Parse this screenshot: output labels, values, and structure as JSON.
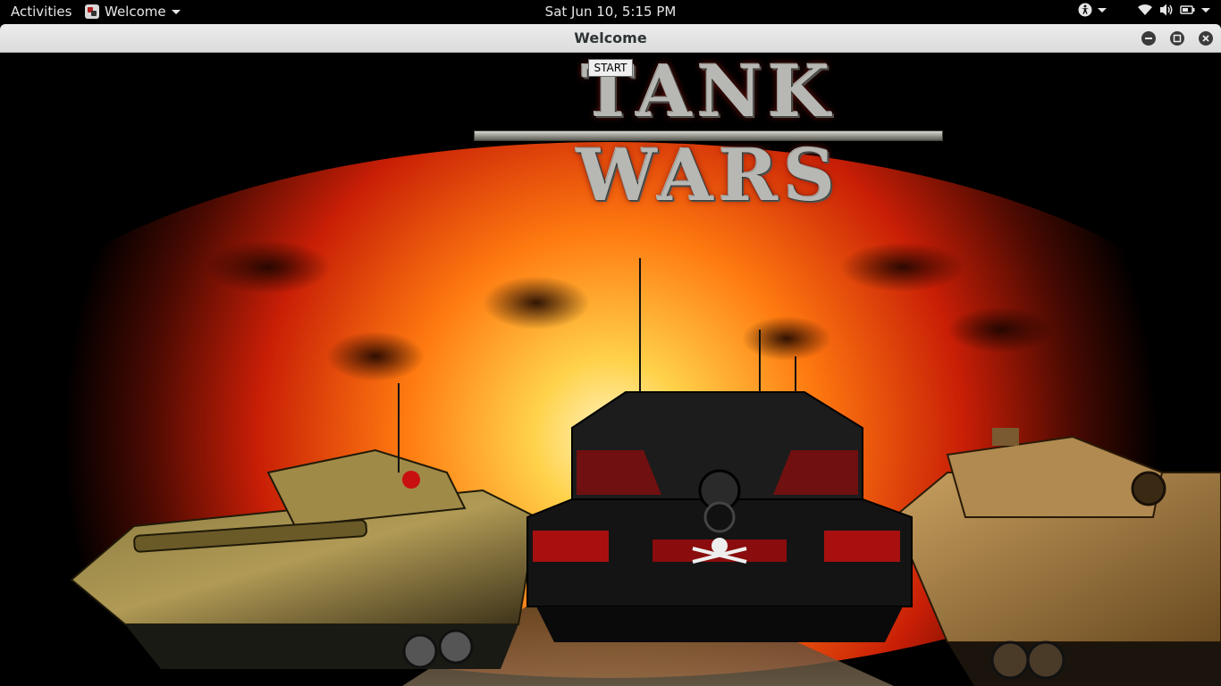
{
  "topbar": {
    "activities": "Activities",
    "app_name": "Welcome",
    "clock": "Sat Jun 10,  5:15 PM",
    "tray_icons": [
      "accessibility-icon",
      "wifi-icon",
      "volume-icon",
      "battery-icon"
    ]
  },
  "window": {
    "title": "Welcome",
    "controls": [
      "minimize",
      "maximize",
      "close"
    ]
  },
  "game": {
    "logo_text": "TANK WARS",
    "start_label": "START"
  },
  "colors": {
    "fire_core": "#ffe07a",
    "fire_mid": "#ff7a10",
    "fire_outer": "#c81e06",
    "titlebar": "#e4e4e4"
  }
}
